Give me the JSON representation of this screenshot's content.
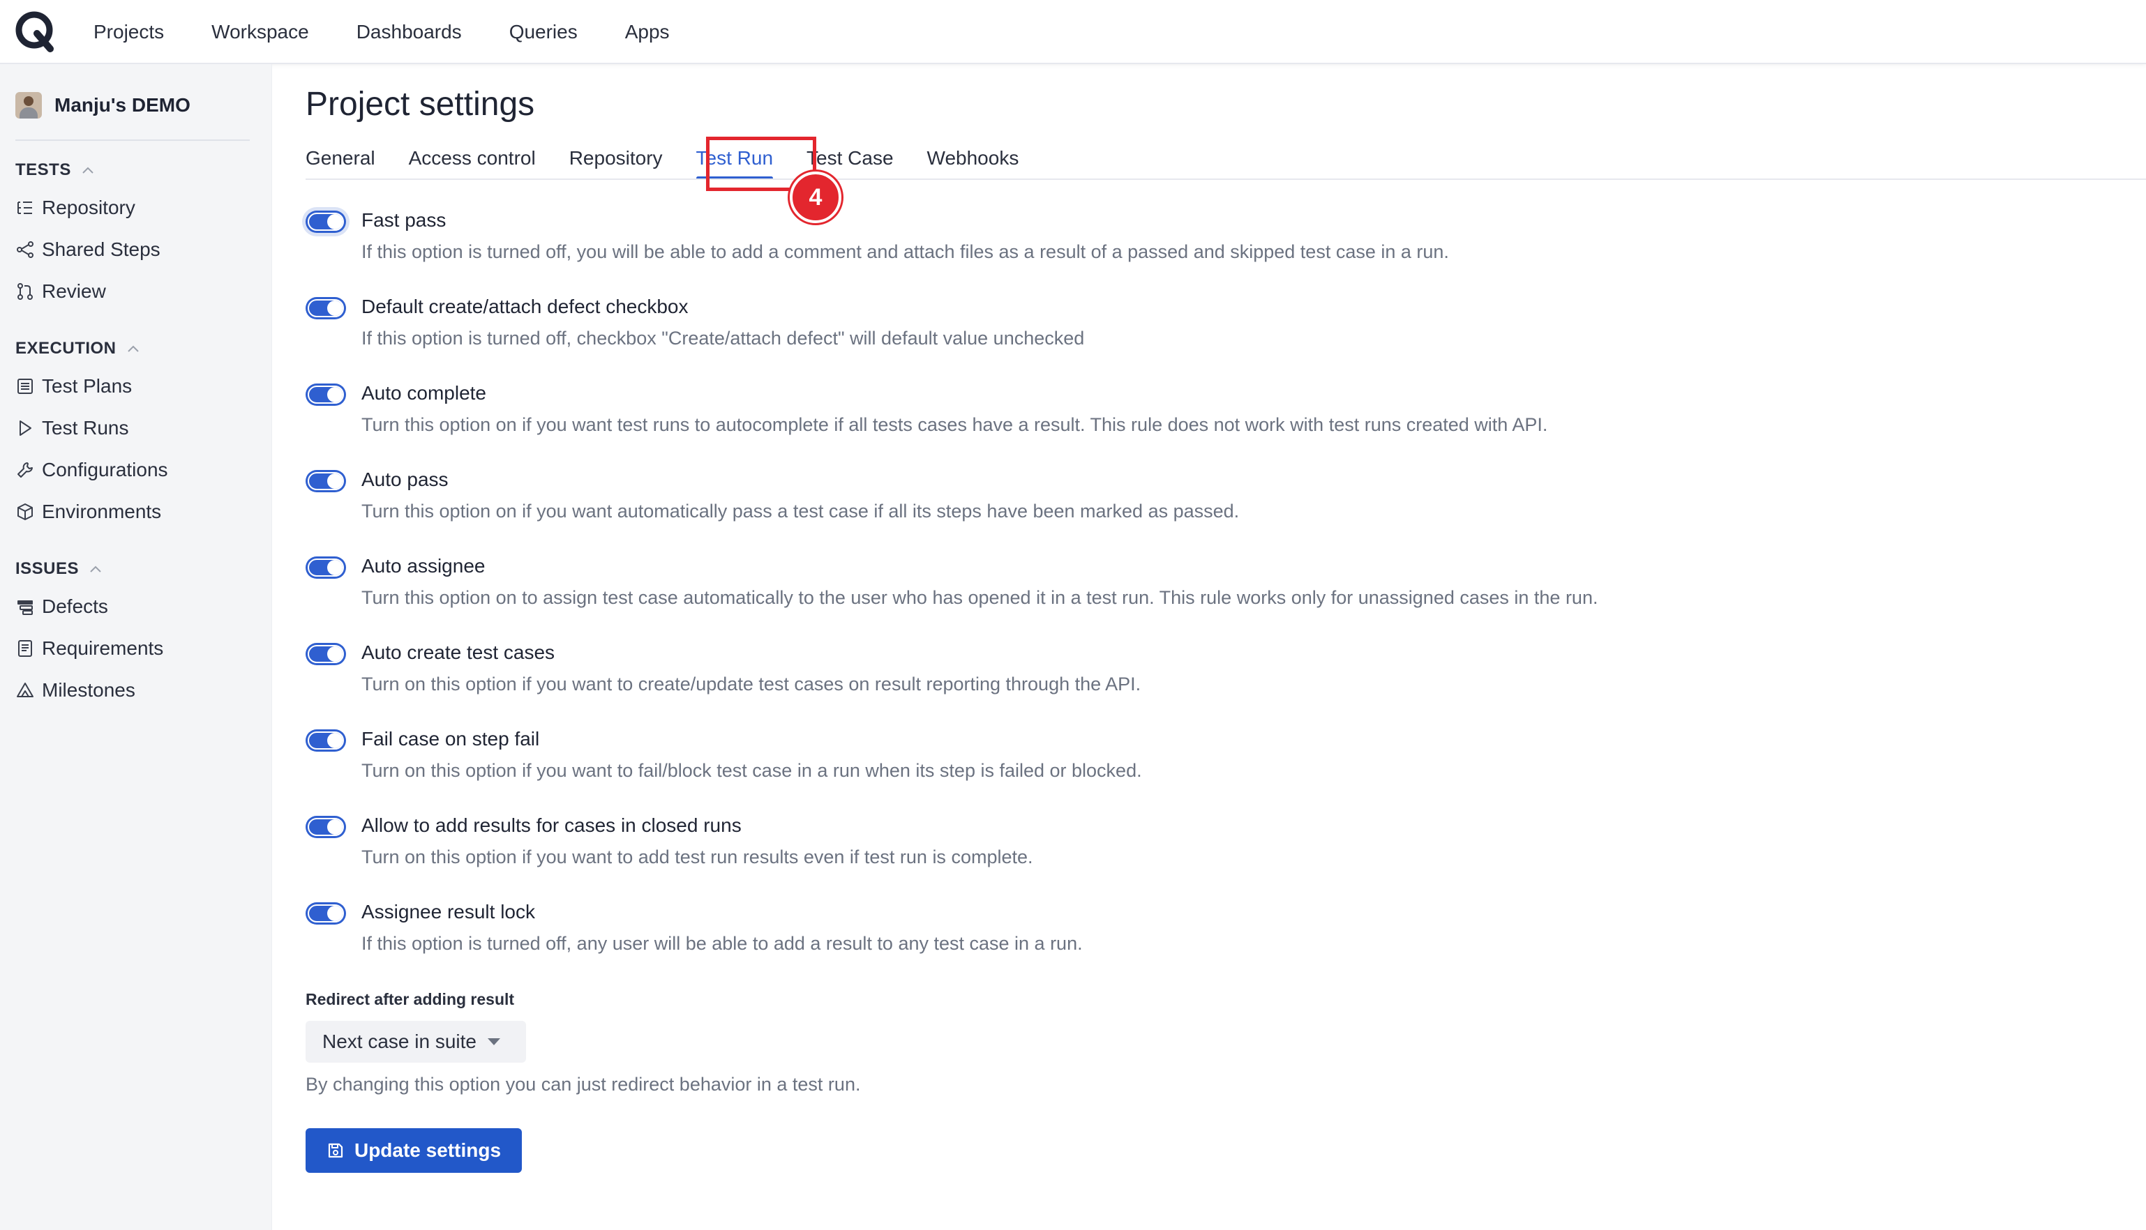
{
  "nav": {
    "logo": "qase-logo-icon",
    "items": [
      "Projects",
      "Workspace",
      "Dashboards",
      "Queries",
      "Apps"
    ]
  },
  "sidebar": {
    "project_name": "Manju's DEMO",
    "sections": [
      {
        "title": "TESTS",
        "items": [
          {
            "label": "Repository",
            "icon": "list-tree-icon"
          },
          {
            "label": "Shared Steps",
            "icon": "share-nodes-icon"
          },
          {
            "label": "Review",
            "icon": "git-pull-request-icon"
          }
        ]
      },
      {
        "title": "EXECUTION",
        "items": [
          {
            "label": "Test Plans",
            "icon": "table-list-icon"
          },
          {
            "label": "Test Runs",
            "icon": "play-outline-icon"
          },
          {
            "label": "Configurations",
            "icon": "wrench-icon"
          },
          {
            "label": "Environments",
            "icon": "cube-icon"
          }
        ]
      },
      {
        "title": "ISSUES",
        "items": [
          {
            "label": "Defects",
            "icon": "bug-stack-icon"
          },
          {
            "label": "Requirements",
            "icon": "document-icon"
          },
          {
            "label": "Milestones",
            "icon": "triangle-flag-icon"
          }
        ]
      }
    ]
  },
  "main": {
    "title": "Project settings",
    "tabs": [
      "General",
      "Access control",
      "Repository",
      "Test Run",
      "Test Case",
      "Webhooks"
    ],
    "active_tab": "Test Run",
    "step_badge": "4",
    "settings": [
      {
        "title": "Fast pass",
        "desc": "If this option is turned off, you will be able to add a comment and attach files as a result of a passed and skipped test case in a run.",
        "enabled": true
      },
      {
        "title": "Default create/attach defect checkbox",
        "desc": "If this option is turned off, checkbox \"Create/attach defect\" will default value unchecked",
        "enabled": true
      },
      {
        "title": "Auto complete",
        "desc": "Turn this option on if you want test runs to autocomplete if all tests cases have a result. This rule does not work with test runs created with API.",
        "enabled": true
      },
      {
        "title": "Auto pass",
        "desc": "Turn this option on if you want automatically pass a test case if all its steps have been marked as passed.",
        "enabled": true
      },
      {
        "title": "Auto assignee",
        "desc": "Turn this option on to assign test case automatically to the user who has opened it in a test run. This rule works only for unassigned cases in the run.",
        "enabled": true
      },
      {
        "title": "Auto create test cases",
        "desc": "Turn on this option if you want to create/update test cases on result reporting through the API.",
        "enabled": true
      },
      {
        "title": "Fail case on step fail",
        "desc": "Turn on this option if you want to fail/block test case in a run when its step is failed or blocked.",
        "enabled": true
      },
      {
        "title": "Allow to add results for cases in closed runs",
        "desc": "Turn on this option if you want to add test run results even if test run is complete.",
        "enabled": true
      },
      {
        "title": "Assignee result lock",
        "desc": "If this option is turned off, any user will be able to add a result to any test case in a run.",
        "enabled": true
      }
    ],
    "redirect": {
      "label": "Redirect after adding result",
      "value": "Next case in suite",
      "help": "By changing this option you can just redirect behavior in a test run."
    },
    "update_button": "Update settings"
  },
  "colors": {
    "accent": "#2f5fd0",
    "button": "#2258c9",
    "highlight": "#e3262e",
    "muted_text": "#6b7280"
  }
}
